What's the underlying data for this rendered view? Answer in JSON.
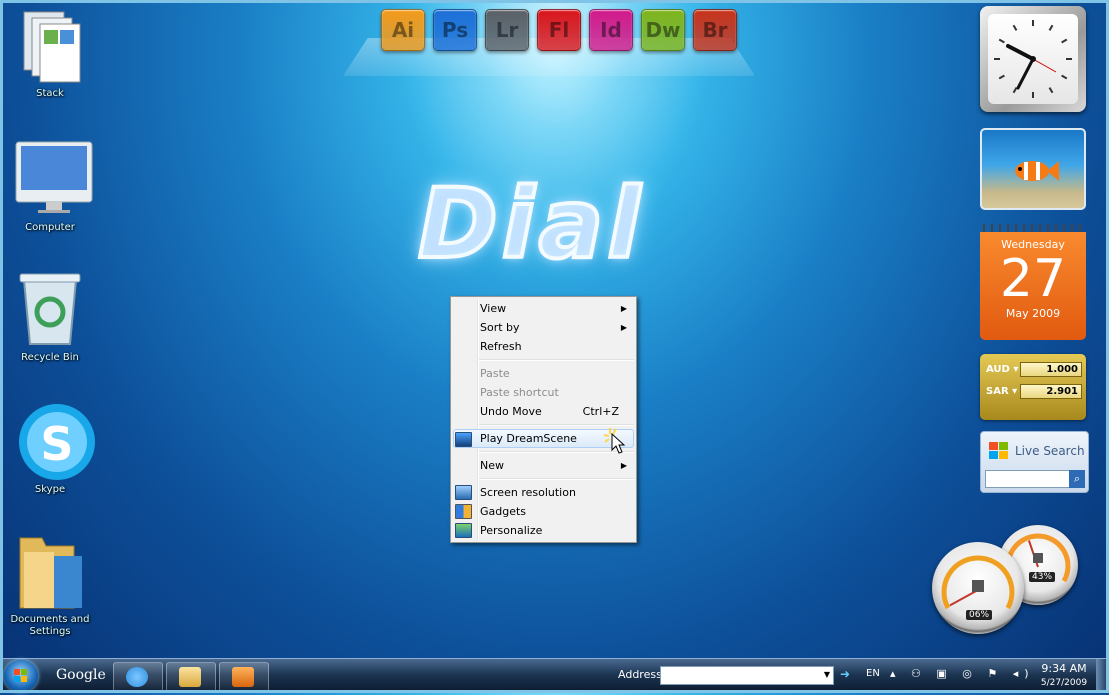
{
  "colors": {
    "menu_bg": "#f1f1f1",
    "menu_highlight": "#dbeaf9",
    "calendar": "#ed6d1e",
    "desktop": "#1a7fc6"
  },
  "wallpaper_title": "Dial",
  "dock": [
    {
      "label": "Ai",
      "color": "#f39a1a"
    },
    {
      "label": "Ps",
      "color": "#1d6fd6"
    },
    {
      "label": "Lr",
      "color": "#5a5f66"
    },
    {
      "label": "Fl",
      "color": "#d9151c"
    },
    {
      "label": "Id",
      "color": "#d2198a"
    },
    {
      "label": "Dw",
      "color": "#7fb41c"
    },
    {
      "label": "Br",
      "color": "#c9331b"
    }
  ],
  "desktop_icons": [
    {
      "label": "Stack",
      "icon": "stack-icon"
    },
    {
      "label": "Computer",
      "icon": "computer-icon"
    },
    {
      "label": "Recycle Bin",
      "icon": "recycle-bin-icon"
    },
    {
      "label": "Skype",
      "icon": "skype-icon"
    },
    {
      "label": "Documents and Settings",
      "icon": "folder-icon"
    }
  ],
  "context_menu": {
    "items": [
      {
        "label": "View",
        "submenu": true
      },
      {
        "label": "Sort by",
        "submenu": true
      },
      {
        "label": "Refresh"
      },
      {
        "label": "Paste",
        "disabled": true
      },
      {
        "label": "Paste shortcut",
        "disabled": true
      },
      {
        "label": "Undo Move",
        "shortcut": "Ctrl+Z"
      },
      {
        "label": "Play DreamScene",
        "icon": "dreamscene-icon",
        "highlighted": true
      },
      {
        "label": "New",
        "submenu": true
      },
      {
        "label": "Screen resolution",
        "icon": "monitor-icon"
      },
      {
        "label": "Gadgets",
        "icon": "gadgets-icon"
      },
      {
        "label": "Personalize",
        "icon": "personalize-icon"
      }
    ]
  },
  "gadgets": {
    "clock_icon": "analog-clock-icon",
    "slideshow_icon": "clownfish-slideshow-icon",
    "calendar": {
      "weekday": "Wednesday",
      "day": "27",
      "month_year": "May 2009"
    },
    "currency": [
      {
        "code": "AUD",
        "value": "1.000"
      },
      {
        "code": "SAR",
        "value": "2.901"
      }
    ],
    "live_search": {
      "title": "Live Search",
      "search_icon": "magnifier-icon"
    },
    "cpu_meter": {
      "cpu": "06%",
      "memory": "43%",
      "cpu_fraction": 0.06,
      "memory_fraction": 0.43
    }
  },
  "taskbar": {
    "start_icon": "windows-orb-icon",
    "google": "Google",
    "buttons": [
      {
        "name": "internet-explorer-icon",
        "color": "#2e8fe0"
      },
      {
        "name": "windows-explorer-icon",
        "color": "#e6c063"
      },
      {
        "name": "media-player-icon",
        "color": "#e07b1a"
      }
    ],
    "address_label": "Address",
    "language": "EN",
    "time": "9:34 AM",
    "date": "5/27/2009"
  }
}
